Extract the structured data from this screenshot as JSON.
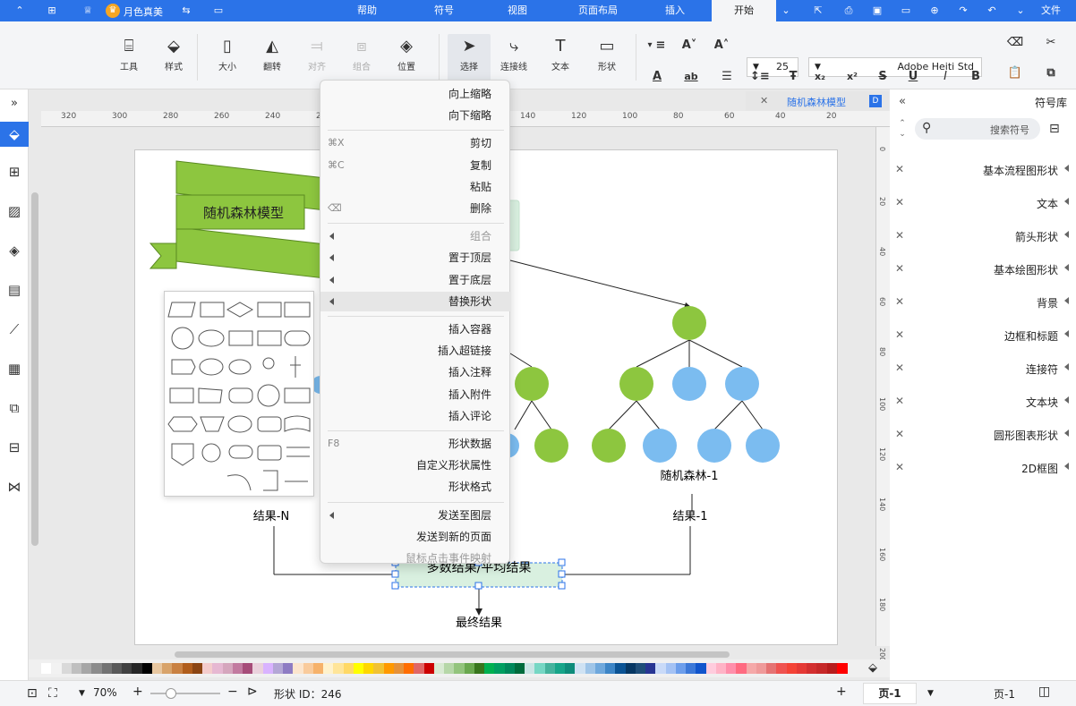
{
  "menubar": {
    "tabs": [
      {
        "label": "文件"
      },
      {
        "label": "开始"
      },
      {
        "label": "插入"
      },
      {
        "label": "页面布局"
      },
      {
        "label": "视图"
      },
      {
        "label": "符号"
      },
      {
        "label": "帮助"
      }
    ],
    "user_name": "月色真美",
    "accent_color": "#2b73e8"
  },
  "toolbar": {
    "font_name": "Adobe Heiti Std",
    "font_size": "25",
    "buttons": [
      {
        "label": "形状",
        "icon": "rectangle-icon"
      },
      {
        "label": "文本",
        "icon": "text-icon"
      },
      {
        "label": "连接线",
        "icon": "connector-icon"
      },
      {
        "label": "选择",
        "icon": "cursor-icon"
      },
      {
        "label": "位置",
        "icon": "layers-icon"
      },
      {
        "label": "组合",
        "icon": "group-icon"
      },
      {
        "label": "对齐",
        "icon": "align-icon"
      },
      {
        "label": "翻转",
        "icon": "flip-icon"
      },
      {
        "label": "大小",
        "icon": "size-icon"
      },
      {
        "label": "样式",
        "icon": "fill-icon"
      },
      {
        "label": "工具",
        "icon": "tools-icon"
      }
    ]
  },
  "library": {
    "title": "符号库",
    "search_placeholder": "搜索符号",
    "items": [
      {
        "label": "基本流程图形状"
      },
      {
        "label": "文本"
      },
      {
        "label": "箭头形状"
      },
      {
        "label": "基本绘图形状"
      },
      {
        "label": "背景"
      },
      {
        "label": "边框和标题"
      },
      {
        "label": "连接符"
      },
      {
        "label": "文本块"
      },
      {
        "label": "圆形图表形状"
      },
      {
        "label": "2D框图"
      }
    ]
  },
  "document_tab": {
    "title": "随机森林模型"
  },
  "ruler": {
    "h_ticks": [
      "320",
      "300",
      "280",
      "260",
      "240",
      "220",
      "200",
      "180",
      "160",
      "140",
      "120",
      "100",
      "80",
      "60",
      "40",
      "20"
    ],
    "v_ticks": [
      "0",
      "20",
      "40",
      "60",
      "80",
      "100",
      "120",
      "140",
      "160",
      "180",
      "200"
    ]
  },
  "context_menu": {
    "items": [
      {
        "label": "向上缩略",
        "key": "",
        "disabled": false,
        "submenu": false
      },
      {
        "label": "向下缩略",
        "key": "",
        "disabled": false,
        "submenu": false
      },
      {
        "sep": true
      },
      {
        "label": "剪切",
        "key": "⌘X",
        "disabled": false,
        "submenu": false
      },
      {
        "label": "复制",
        "key": "⌘C",
        "disabled": false,
        "submenu": false
      },
      {
        "label": "粘贴",
        "key": "",
        "disabled": false,
        "submenu": false
      },
      {
        "label": "删除",
        "key": "⌫",
        "disabled": false,
        "submenu": false
      },
      {
        "sep": true
      },
      {
        "label": "组合",
        "key": "",
        "disabled": true,
        "submenu": true
      },
      {
        "label": "置于顶层",
        "key": "",
        "disabled": false,
        "submenu": true
      },
      {
        "label": "置于底层",
        "key": "",
        "disabled": false,
        "submenu": true
      },
      {
        "label": "替换形状",
        "key": "",
        "disabled": false,
        "submenu": true,
        "highlight": true
      },
      {
        "sep": true
      },
      {
        "label": "插入容器",
        "key": "",
        "disabled": false,
        "submenu": false
      },
      {
        "label": "插入超链接",
        "key": "",
        "disabled": false,
        "submenu": false
      },
      {
        "label": "插入注释",
        "key": "",
        "disabled": false,
        "submenu": false
      },
      {
        "label": "插入附件",
        "key": "",
        "disabled": false,
        "submenu": false
      },
      {
        "label": "插入评论",
        "key": "",
        "disabled": false,
        "submenu": false
      },
      {
        "sep": true
      },
      {
        "label": "形状数据",
        "key": "F8",
        "disabled": false,
        "submenu": false
      },
      {
        "label": "自定义形状属性",
        "key": "",
        "disabled": false,
        "submenu": false
      },
      {
        "label": "形状格式",
        "key": "",
        "disabled": false,
        "submenu": false
      },
      {
        "sep": true
      },
      {
        "label": "发送至图层",
        "key": "",
        "disabled": false,
        "submenu": true
      },
      {
        "label": "发送到新的页面",
        "key": "",
        "disabled": false,
        "submenu": false
      },
      {
        "label": "鼠标点击事件映射",
        "key": "",
        "disabled": true,
        "submenu": false
      }
    ]
  },
  "diagram": {
    "banner_title": "随机森林模型",
    "tree_label_1": "随机森林-1",
    "result_1": "结果-1",
    "result_n": "结果-N",
    "majority_box": "多数结果/平均结果",
    "final_result": "最终结果",
    "green": "#8dc63f",
    "blue": "#7bbcf0"
  },
  "statusbar": {
    "page_left": "页-1",
    "page_tab": "页-1",
    "shape_id": "形状 ID：246",
    "zoom": "70%",
    "zoom_fraction": 0.7
  },
  "palette": [
    "#ffffff",
    "#f2f2f2",
    "#d9d9d9",
    "#bfbfbf",
    "#a6a6a6",
    "#8c8c8c",
    "#737373",
    "#595959",
    "#404040",
    "#262626",
    "#000000",
    "#e8c7a0",
    "#d8a36a",
    "#c98142",
    "#b05d1c",
    "#8b4513",
    "#f4cccc",
    "#e6b8d2",
    "#d5a6bd",
    "#c27ba0",
    "#a64d79",
    "#ead1dc",
    "#d9b3ff",
    "#b4a7d6",
    "#8e7cc3",
    "#fce5cd",
    "#f9cb9c",
    "#f6b26b",
    "#fff2cc",
    "#ffe599",
    "#ffd966",
    "#ffff00",
    "#ffd700",
    "#f1c232",
    "#ff9900",
    "#e69138",
    "#ff6d01",
    "#e06666",
    "#cc0000",
    "#d9ead3",
    "#b6d7a8",
    "#93c47d",
    "#6aa84f",
    "#38761d",
    "#00b050",
    "#009e60",
    "#00875a",
    "#006b3c",
    "#c9e5e5",
    "#76d7c4",
    "#45b39d",
    "#17a589",
    "#0e8c7a",
    "#cfe2f3",
    "#9fc5e8",
    "#6fa8dc",
    "#3d85c6",
    "#0b5394",
    "#073763",
    "#1f4e79",
    "#283593",
    "#c9daf8",
    "#a4c2f4",
    "#6d9eeb",
    "#3c78d8",
    "#1155cc",
    "#ffccdd",
    "#ffb3c6",
    "#ff8fab",
    "#ff6b81",
    "#f5a9a9",
    "#ef9a9a",
    "#e57373",
    "#ef5350",
    "#f44336",
    "#e53935",
    "#d32f2f",
    "#c62828",
    "#b71c1c",
    "#ff0000"
  ]
}
